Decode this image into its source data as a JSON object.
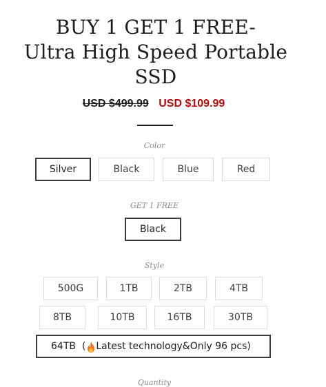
{
  "product": {
    "title_lines": [
      "BUY 1 GET 1 FREE-",
      "Ultra High Speed Portable",
      "SSD"
    ],
    "compare_price": "USD $499.99",
    "sale_price": "USD $109.99"
  },
  "colors": {
    "sale": "#b00b0b",
    "text": "#1c1d1d",
    "label": "#8c8c8c",
    "border": "#dcdcdc"
  },
  "options": {
    "color": {
      "label": "Color",
      "values": [
        "Silver",
        "Black",
        "Blue",
        "Red"
      ],
      "selected": "Silver"
    },
    "get_free": {
      "label": "GET 1 FREE",
      "values": [
        "Black"
      ],
      "selected": "Black"
    },
    "style": {
      "label": "Style",
      "values": [
        "500G",
        "1TB",
        "2TB",
        "4TB",
        "8TB",
        "10TB",
        "16TB",
        "30TB"
      ],
      "wide_prefix": "64TB  (",
      "wide_icon": "fire-emoji-icon",
      "wide_suffix": "Latest technology&Only 96 pcs)",
      "selected": "64TB"
    }
  },
  "quantity": {
    "label": "Quantity"
  }
}
